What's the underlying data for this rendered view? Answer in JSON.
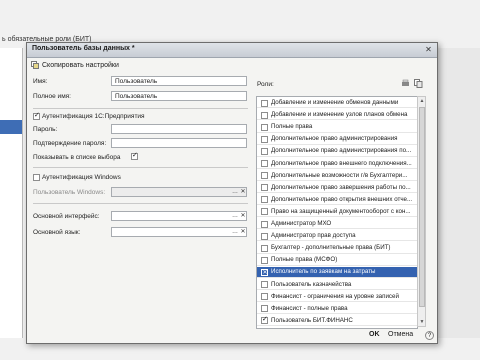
{
  "background": {
    "title_fragment": "ь обязательные роли (БИТ)"
  },
  "dialog": {
    "title": "Пользователь базы данных *",
    "toolbar": {
      "copy_label": "Скопировать настройки"
    },
    "fields": {
      "name_label": "Имя:",
      "name_value": "Пользователь",
      "fullname_label": "Полное имя:",
      "fullname_value": "Пользователь",
      "auth1c_label": "Аутентификация 1С:Предприятия",
      "auth1c_checked": true,
      "password_label": "Пароль:",
      "password_value": "",
      "confirm_label": "Подтверждение пароля:",
      "confirm_value": "",
      "showlist_label": "Показывать в списке выбора",
      "showlist_checked": true,
      "authwin_label": "Аутентификация Windows",
      "authwin_checked": false,
      "winuser_label": "Пользователь Windows:",
      "winuser_value": "",
      "interface_label": "Основной интерфейс:",
      "interface_value": "",
      "language_label": "Основной язык:",
      "language_value": ""
    },
    "roles_label": "Роли:",
    "roles": [
      {
        "label": "Добавление и изменение обменов данными",
        "checked": false
      },
      {
        "label": "Добавление и изменение узлов планов обмена",
        "checked": false
      },
      {
        "label": "Полные права",
        "checked": false
      },
      {
        "label": "Дополнительное право администрирования",
        "checked": false
      },
      {
        "label": "Дополнительное право администрирования по...",
        "checked": false
      },
      {
        "label": "Дополнительное право внешнего подключения...",
        "checked": false
      },
      {
        "label": "Дополнительные возможности г/в Бухгалтери...",
        "checked": false
      },
      {
        "label": "Дополнительное право завершения работы по...",
        "checked": false
      },
      {
        "label": "Дополнительное право открытия внешних отче...",
        "checked": false
      },
      {
        "label": "Право на защищенный документооборот с кон...",
        "checked": false
      },
      {
        "label": "Администратор МХО",
        "checked": false
      },
      {
        "label": "Администратор прав доступа",
        "checked": false
      },
      {
        "label": "Бухгалтер - дополнительные права (БИТ)",
        "checked": false
      },
      {
        "label": "Полные права (МСФО)",
        "checked": false
      },
      {
        "label": "Исполнитель по заявкам на затраты",
        "checked": true,
        "selected": true
      },
      {
        "label": "Пользователь казначейства",
        "checked": false
      },
      {
        "label": "Финансист - ограничения на уровне записей",
        "checked": false
      },
      {
        "label": "Финансист - полные права",
        "checked": false
      },
      {
        "label": "Пользователь БИТ.ФИНАНС",
        "checked": true
      }
    ],
    "buttons": {
      "ok": "OK",
      "cancel": "Отмена",
      "help": "?"
    }
  }
}
